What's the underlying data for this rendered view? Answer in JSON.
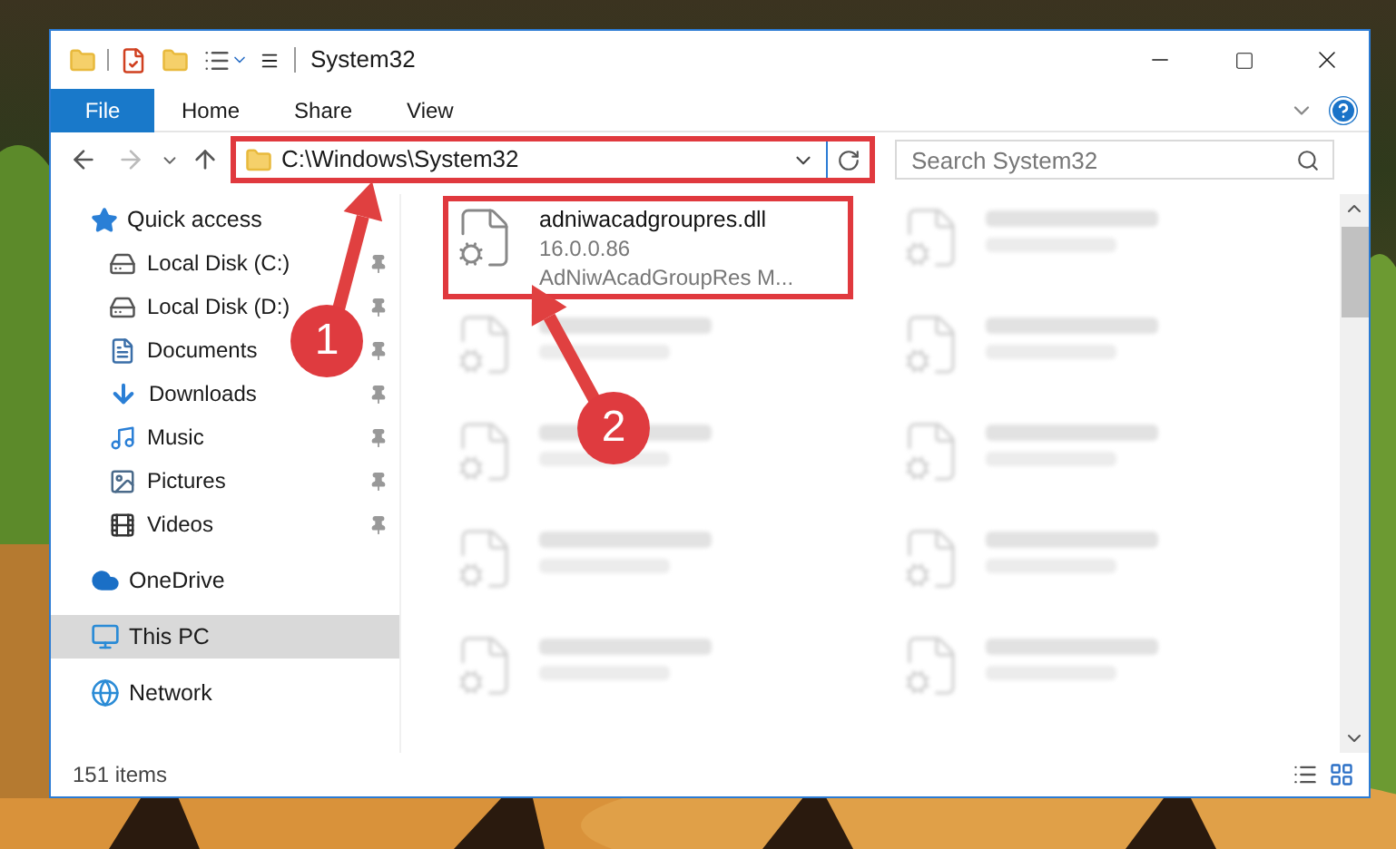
{
  "window": {
    "title": "System32"
  },
  "file_button": "File",
  "ribbon_tabs": [
    "Home",
    "Share",
    "View"
  ],
  "address_bar": {
    "path": "C:\\Windows\\System32",
    "highlighted": true
  },
  "search": {
    "placeholder": "Search System32"
  },
  "navigation": [
    {
      "label": "Quick access",
      "selected": false,
      "children": [
        {
          "label": "Local Disk (C:)",
          "pinned": true
        },
        {
          "label": "Local Disk (D:)",
          "pinned": true
        },
        {
          "label": "Documents",
          "pinned": true
        },
        {
          "label": "Downloads",
          "pinned": true
        },
        {
          "label": "Music",
          "pinned": true
        },
        {
          "label": "Pictures",
          "pinned": true
        },
        {
          "label": "Videos",
          "pinned": true
        }
      ]
    },
    {
      "label": "OneDrive",
      "selected": false
    },
    {
      "label": "This PC",
      "selected": true
    },
    {
      "label": "Network",
      "selected": false
    }
  ],
  "files": [
    {
      "name": "adniwacadgroupres.dll",
      "details": [
        "16.0.0.86",
        "AdNiwAcadGroupRes M..."
      ],
      "highlighted": true,
      "blurred": false
    },
    {
      "highlighted": false,
      "blurred": true
    },
    {
      "highlighted": false,
      "blurred": true
    },
    {
      "highlighted": false,
      "blurred": true
    },
    {
      "highlighted": false,
      "blurred": true
    },
    {
      "highlighted": false,
      "blurred": true
    },
    {
      "highlighted": false,
      "blurred": true
    },
    {
      "highlighted": false,
      "blurred": true
    },
    {
      "highlighted": false,
      "blurred": true
    },
    {
      "highlighted": false,
      "blurred": true
    }
  ],
  "callouts": [
    {
      "number": "1"
    },
    {
      "number": "2"
    }
  ],
  "status_bar": {
    "item_count": "151 items"
  }
}
